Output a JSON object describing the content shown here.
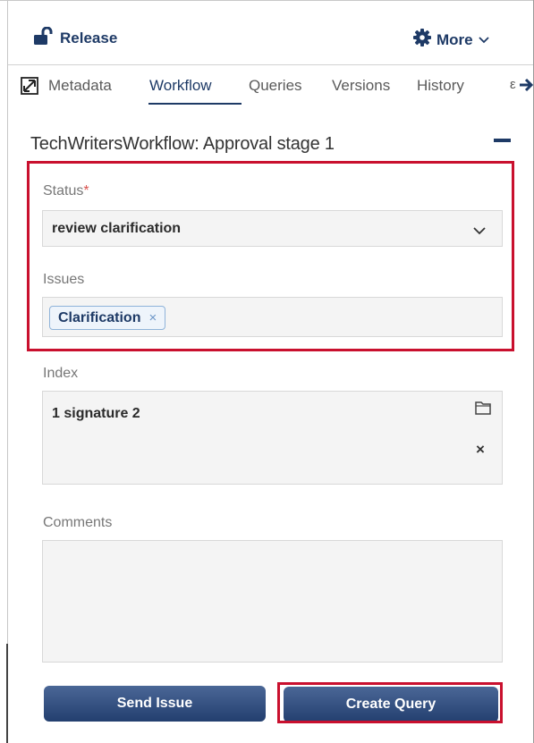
{
  "header": {
    "release_label": "Release",
    "more_label": "More"
  },
  "tabs": [
    {
      "label": "Metadata",
      "active": false
    },
    {
      "label": "Workflow",
      "active": true
    },
    {
      "label": "Queries",
      "active": false
    },
    {
      "label": "Versions",
      "active": false
    },
    {
      "label": "History",
      "active": false
    }
  ],
  "tab_overflow": "ε",
  "section": {
    "title": "TechWritersWorkflow: Approval stage 1"
  },
  "status": {
    "label": "Status",
    "required_marker": "*",
    "value": "review clarification"
  },
  "issues": {
    "label": "Issues",
    "chips": [
      {
        "label": "Clarification",
        "remove": "×"
      }
    ]
  },
  "index": {
    "label": "Index",
    "value": "1 signature 2",
    "remove": "×"
  },
  "comments": {
    "label": "Comments",
    "value": ""
  },
  "buttons": {
    "send_issue": "Send Issue",
    "create_query": "Create Query"
  },
  "colors": {
    "accent": "#1e3a66",
    "highlight": "#c9102e",
    "required": "#d9534f",
    "field_bg": "#f4f4f4"
  },
  "icons": {
    "release": "unlock-icon",
    "more": "gear-icon",
    "tabs_expand": "expand-icon",
    "tabs_next": "arrow-right-icon",
    "index_browse": "folder-icon"
  }
}
